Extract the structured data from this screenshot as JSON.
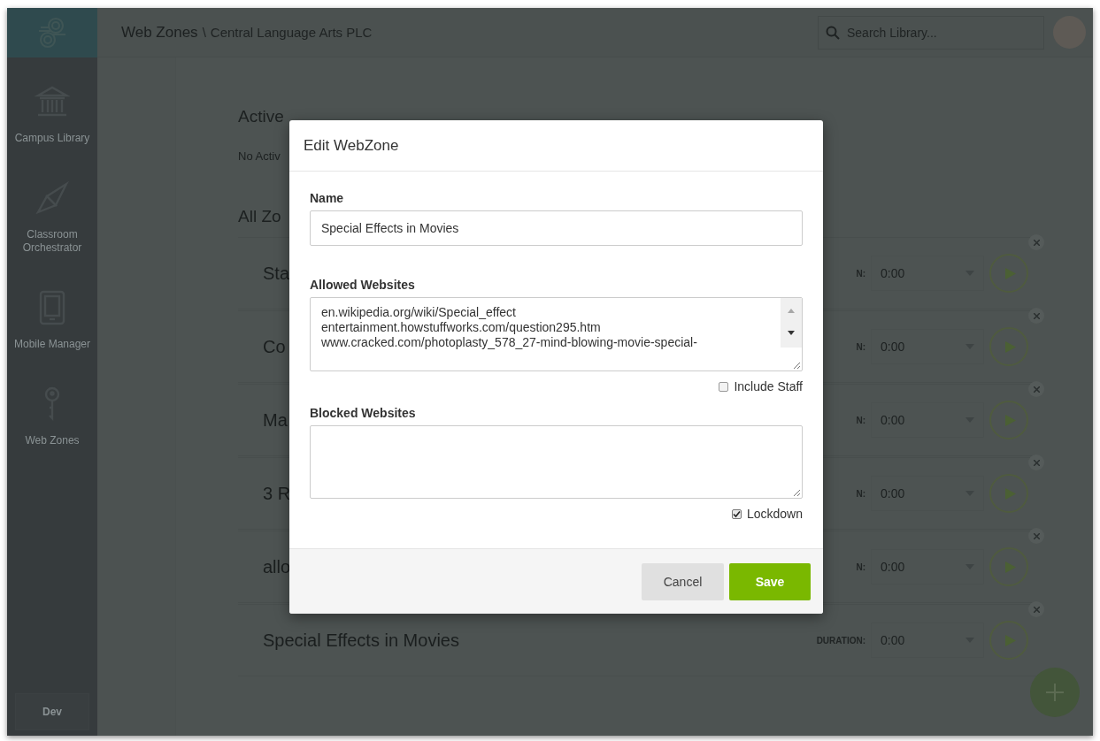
{
  "header": {
    "breadcrumb_root": "Web Zones",
    "breadcrumb_separator": "\\",
    "breadcrumb_current": "Central Language Arts PLC",
    "search": {
      "placeholder": "Search Library..."
    }
  },
  "sidebar": {
    "items": [
      {
        "label": "Campus Library",
        "kind": "library"
      },
      {
        "label": "Classroom Orchestrator",
        "kind": "orchestrator"
      },
      {
        "label": "Mobile Manager",
        "kind": "mobile"
      },
      {
        "label": "Web Zones",
        "kind": "key"
      }
    ],
    "footer_button": "Dev"
  },
  "content": {
    "active_heading": "Active",
    "active_empty": "No Activ",
    "all_heading": "All Zo",
    "zones": [
      {
        "name": "Sta",
        "duration_label": "N:",
        "duration": "0:00"
      },
      {
        "name": "Co",
        "duration_label": "N:",
        "duration": "0:00"
      },
      {
        "name": "Ma",
        "duration_label": "N:",
        "duration": "0:00"
      },
      {
        "name": "3 R",
        "duration_label": "N:",
        "duration": "0:00"
      },
      {
        "name": "allo",
        "duration_label": "N:",
        "duration": "0:00"
      },
      {
        "name": "Special Effects in Movies",
        "duration_label": "DURATION:",
        "duration": "0:00"
      }
    ]
  },
  "modal": {
    "title": "Edit WebZone",
    "name_label": "Name",
    "name_value": "Special Effects in Movies",
    "allowed_label": "Allowed Websites",
    "allowed_websites": [
      "en.wikipedia.org/wiki/Special_effect",
      "entertainment.howstuffworks.com/question295.htm",
      "www.cracked.com/photoplasty_578_27-mind-blowing-movie-special-"
    ],
    "include_staff": {
      "label": "Include Staff",
      "checked": false
    },
    "blocked_label": "Blocked Websites",
    "lockdown": {
      "label": "Lockdown",
      "checked": true
    },
    "buttons": [
      {
        "label": "Cancel",
        "kind": "secondary"
      },
      {
        "label": "Save",
        "kind": "primary"
      }
    ]
  }
}
